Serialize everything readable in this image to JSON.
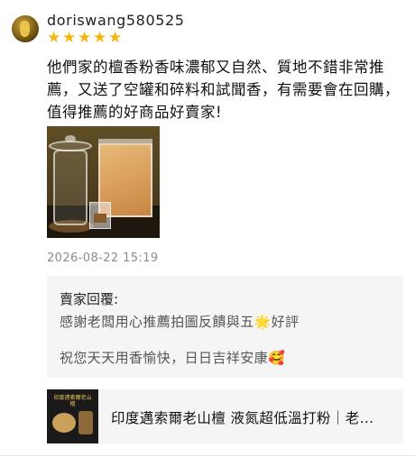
{
  "review": {
    "username": "doriswang580525",
    "rating": 5,
    "stars": [
      "★",
      "★",
      "★",
      "★",
      "★"
    ],
    "text": "他們家的檀香粉香味濃郁又自然、質地不錯非常推薦，又送了空罐和碎料和試聞香，有需要會在回購，值得推薦的好商品好賣家!",
    "photo_icon": "product-photo",
    "timestamp": "2026-08-22 15:19"
  },
  "seller_reply": {
    "title": "賣家回覆:",
    "line1": "感謝老闆用心推薦拍圖反饋與五🌟好評",
    "line2": "祝您天天用香愉快，日日吉祥安康🥰"
  },
  "product": {
    "name": "印度邁索爾老山檀 液氮超低溫打粉｜老…",
    "thumb_text": "印度邁索爾老山檀"
  },
  "colors": {
    "star": "#f6b40e",
    "reply_bg": "#f5f5f5",
    "timestamp": "#8c8c8c"
  }
}
